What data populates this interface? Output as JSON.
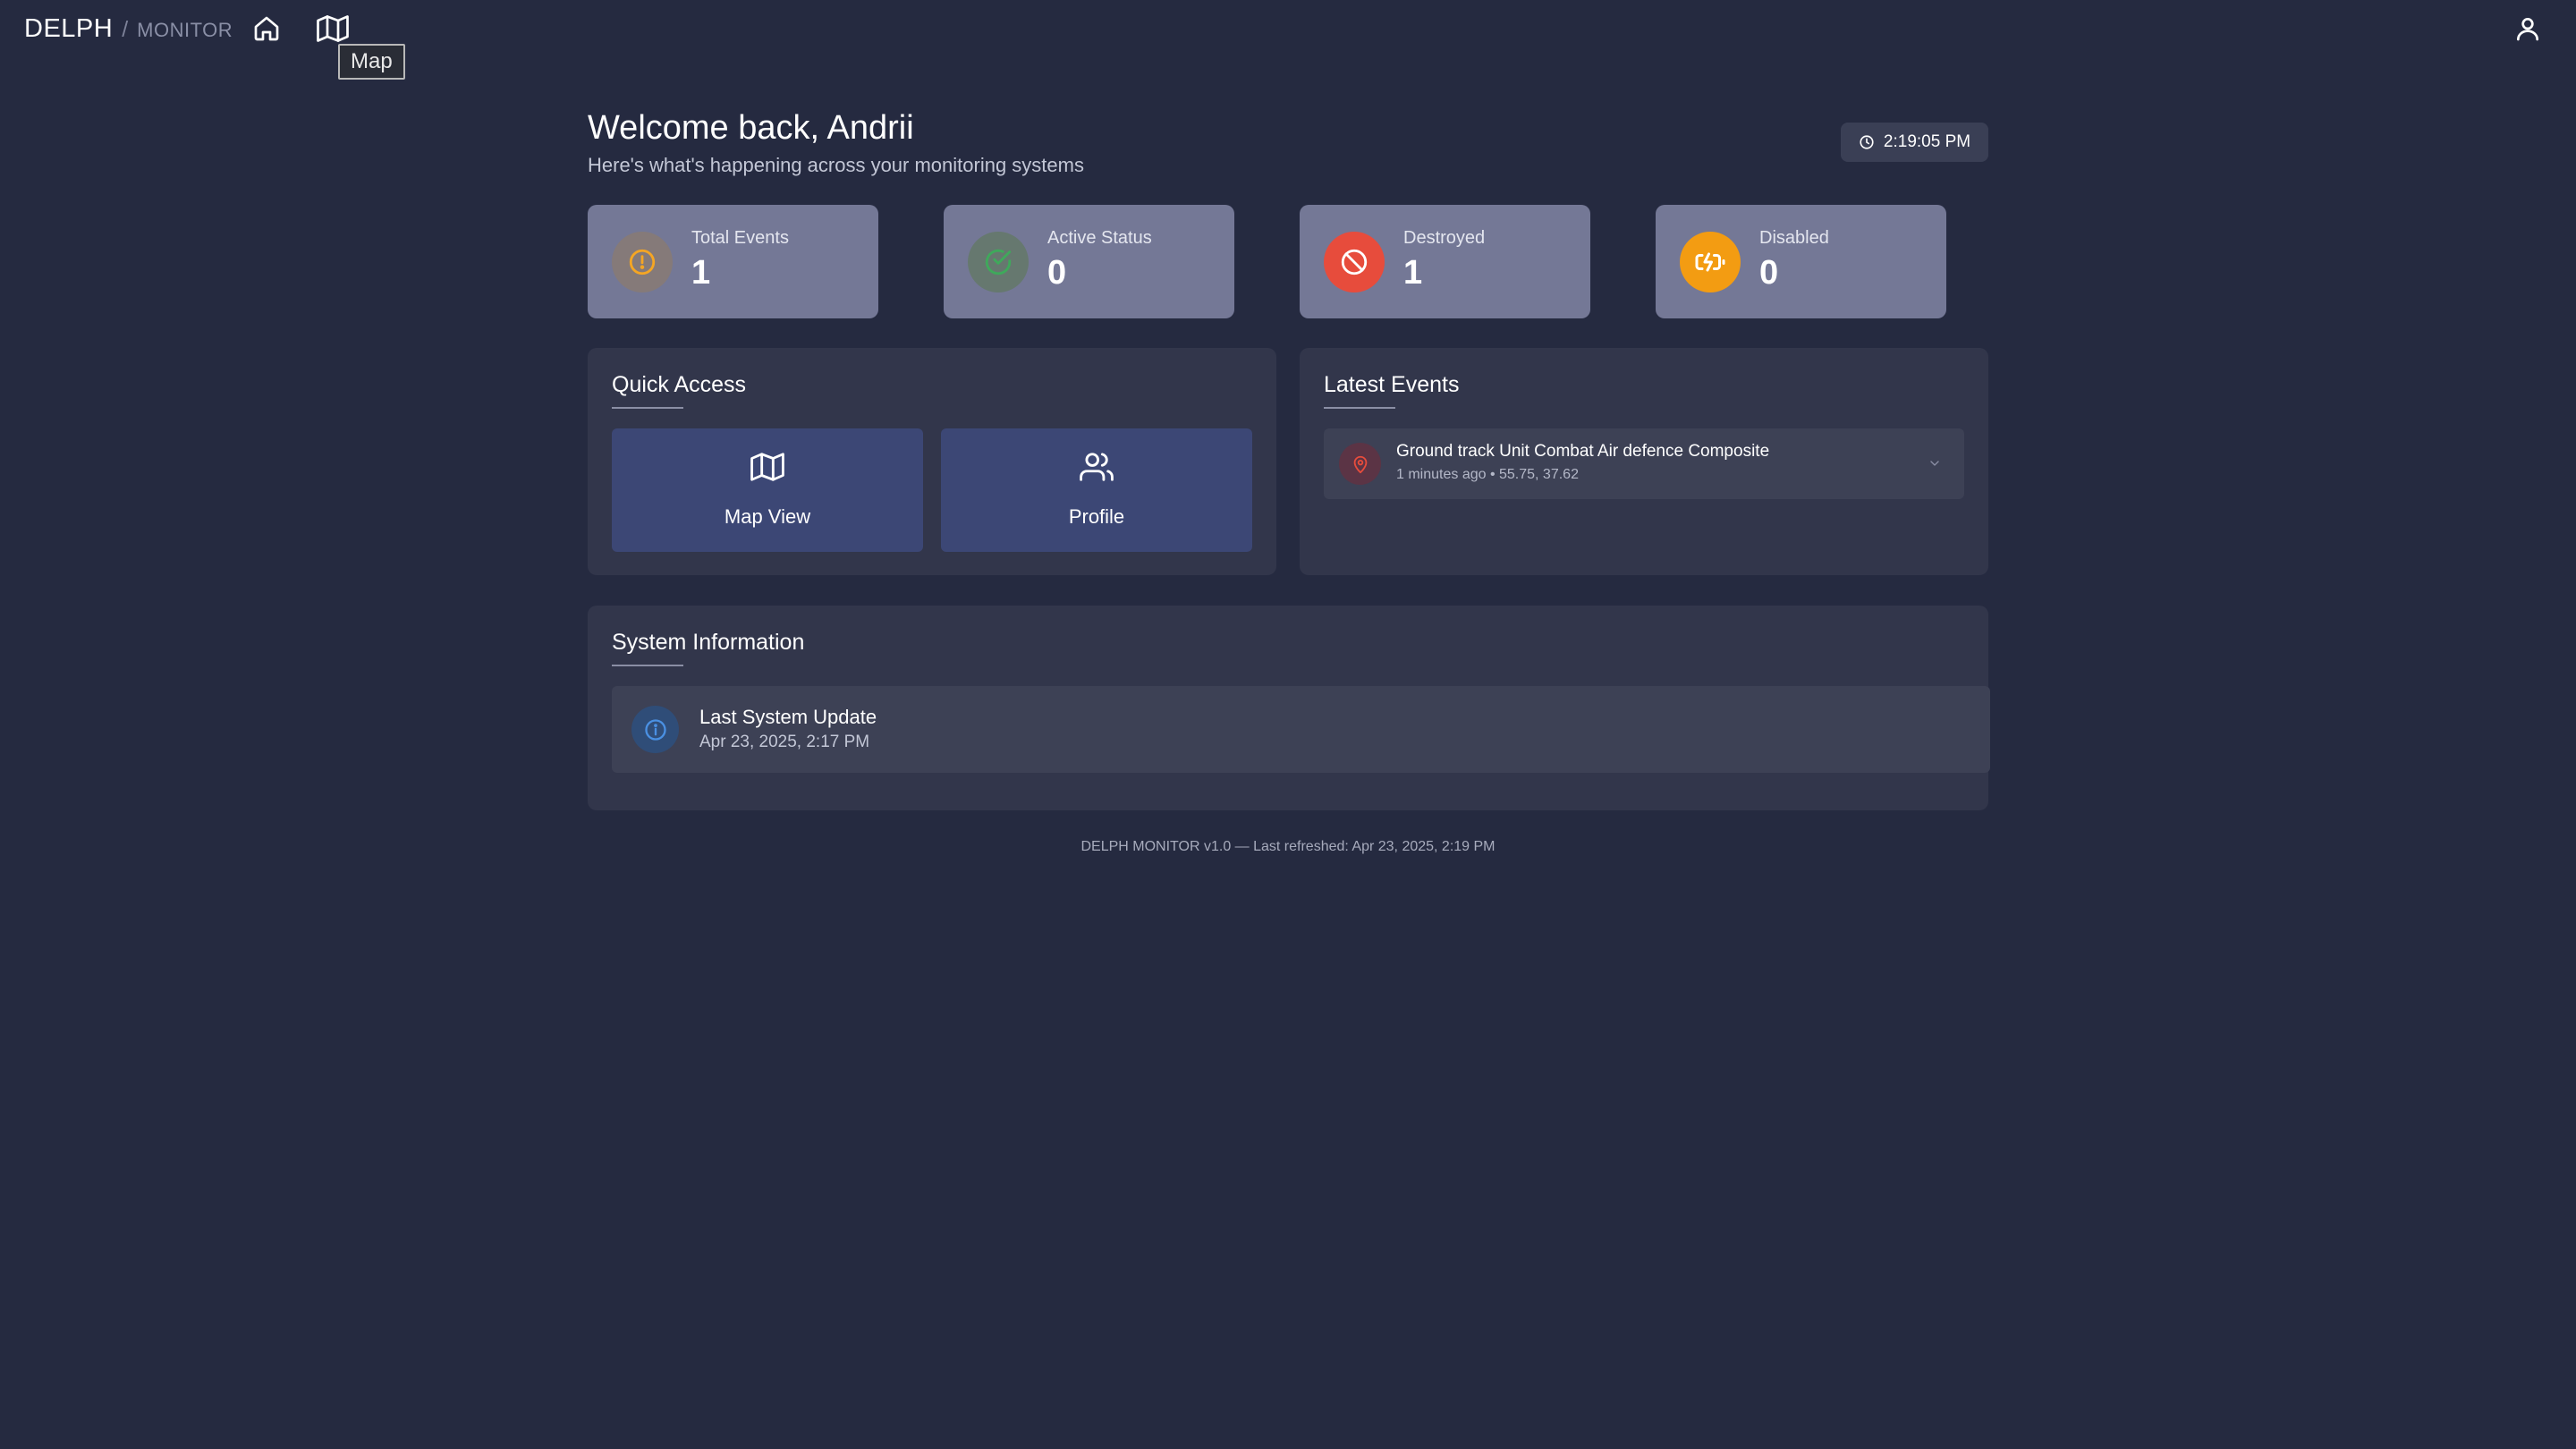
{
  "brand": {
    "name": "DELPH",
    "separator": "/",
    "section": "MONITOR"
  },
  "nav": {
    "home_icon": "home-icon",
    "map_icon": "map-icon",
    "user_icon": "user-icon",
    "tooltip": "Map"
  },
  "welcome": {
    "title": "Welcome back, Andrii",
    "subtitle": "Here's what's happening across your monitoring systems"
  },
  "clock": {
    "icon": "clock-icon",
    "time": "2:19:05 PM"
  },
  "stats": [
    {
      "label": "Total Events",
      "value": "1",
      "icon": "alert-circle-icon",
      "color": "#f5a623"
    },
    {
      "label": "Active Status",
      "value": "0",
      "icon": "check-circle-icon",
      "color": "#3fa95b"
    },
    {
      "label": "Destroyed",
      "value": "1",
      "icon": "ban-icon",
      "color": "#e74c3c"
    },
    {
      "label": "Disabled",
      "value": "0",
      "icon": "battery-charging-icon",
      "color": "#f39c12"
    }
  ],
  "quick_access": {
    "title": "Quick Access",
    "tiles": [
      {
        "label": "Map View",
        "icon": "map-icon"
      },
      {
        "label": "Profile",
        "icon": "users-icon"
      }
    ]
  },
  "latest_events": {
    "title": "Latest Events",
    "items": [
      {
        "title": "Ground track Unit Combat Air defence Composite",
        "meta": "1 minutes ago • 55.75, 37.62",
        "icon": "map-pin-icon"
      }
    ]
  },
  "system_info": {
    "title": "System Information",
    "items": [
      {
        "title": "Last System Update",
        "value": "Apr 23, 2025, 2:17 PM",
        "icon": "info-icon"
      }
    ]
  },
  "footer": "DELPH MONITOR v1.0 — Last refreshed: Apr 23, 2025, 2:19 PM",
  "colors": {
    "background": "#252a40",
    "panel": "#32364b",
    "stat_card": "#747896",
    "tile": "#3c4775"
  }
}
